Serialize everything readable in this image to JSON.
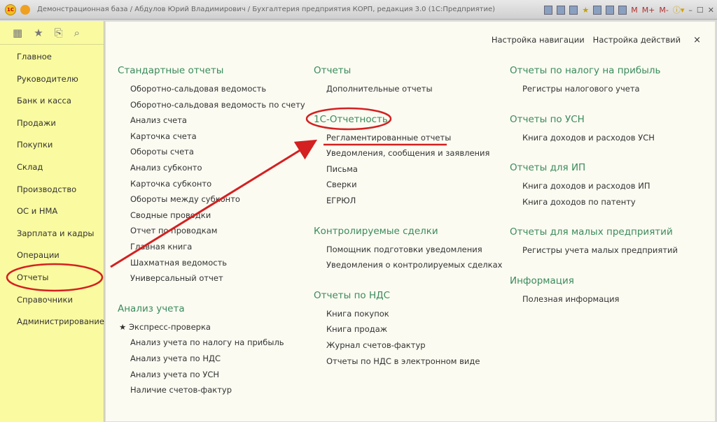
{
  "window": {
    "title": "Демонстрационная база / Абдулов Юрий Владимирович / Бухгалтерия предприятия КОРП, редакция 3.0  (1С:Предприятие)",
    "logo": "1С",
    "tools": [
      "M",
      "M+",
      "M-"
    ],
    "icons": [
      "save-icon",
      "print-icon",
      "preview-icon",
      "favorite-icon",
      "history-icon",
      "calculator-icon",
      "calendar-icon",
      "info-icon",
      "minimize-icon",
      "maximize-icon",
      "close-icon"
    ]
  },
  "sidebar": {
    "icons": [
      "apps-grid-icon",
      "star-icon",
      "history-icon",
      "search-icon"
    ],
    "items": [
      "Главное",
      "Руководителю",
      "Банк и касса",
      "Продажи",
      "Покупки",
      "Склад",
      "Производство",
      "ОС и НМА",
      "Зарплата и кадры",
      "Операции",
      "Отчеты",
      "Справочники",
      "Администрирование"
    ],
    "active": "Отчеты"
  },
  "topnav": {
    "nav_settings": "Настройка навигации",
    "action_settings": "Настройка действий",
    "close": "×"
  },
  "columns": [
    [
      {
        "title": "Стандартные отчеты",
        "items": [
          "Оборотно-сальдовая ведомость",
          "Оборотно-сальдовая ведомость по счету",
          "Анализ счета",
          "Карточка счета",
          "Обороты счета",
          "Анализ субконто",
          "Карточка субконто",
          "Обороты между субконто",
          "Сводные проводки",
          "Отчет по проводкам",
          "Главная книга",
          "Шахматная ведомость",
          "Универсальный отчет"
        ]
      },
      {
        "title": "Анализ учета",
        "items": [
          "Экспресс-проверка",
          "Анализ учета по налогу на прибыль",
          "Анализ учета по НДС",
          "Анализ учета по УСН",
          "Наличие счетов-фактур"
        ]
      }
    ],
    [
      {
        "title": "Отчеты",
        "items": [
          "Дополнительные отчеты"
        ]
      },
      {
        "title": "1С-Отчетность",
        "items": [
          "Регламентированные отчеты",
          "Уведомления, сообщения и заявления",
          "Письма",
          "Сверки",
          "ЕГРЮЛ"
        ]
      },
      {
        "title": "Контролируемые сделки",
        "items": [
          "Помощник подготовки уведомления",
          "Уведомления о контролируемых сделках"
        ]
      },
      {
        "title": "Отчеты по НДС",
        "items": [
          "Книга покупок",
          "Книга продаж",
          "Журнал счетов-фактур",
          "Отчеты по НДС в электронном виде"
        ]
      }
    ],
    [
      {
        "title": "Отчеты по налогу на прибыль",
        "items": [
          "Регистры налогового учета"
        ]
      },
      {
        "title": "Отчеты по УСН",
        "items": [
          "Книга доходов и расходов УСН"
        ]
      },
      {
        "title": "Отчеты для ИП",
        "items": [
          "Книга доходов и расходов ИП",
          "Книга доходов по патенту"
        ]
      },
      {
        "title": "Отчеты для малых предприятий",
        "items": [
          "Регистры учета малых предприятий"
        ]
      },
      {
        "title": "Информация",
        "items": [
          "Полезная информация"
        ]
      }
    ]
  ],
  "colors": {
    "sidebar": "#fafaa0",
    "heading": "#3b8b5b",
    "annotation": "#d42020"
  }
}
